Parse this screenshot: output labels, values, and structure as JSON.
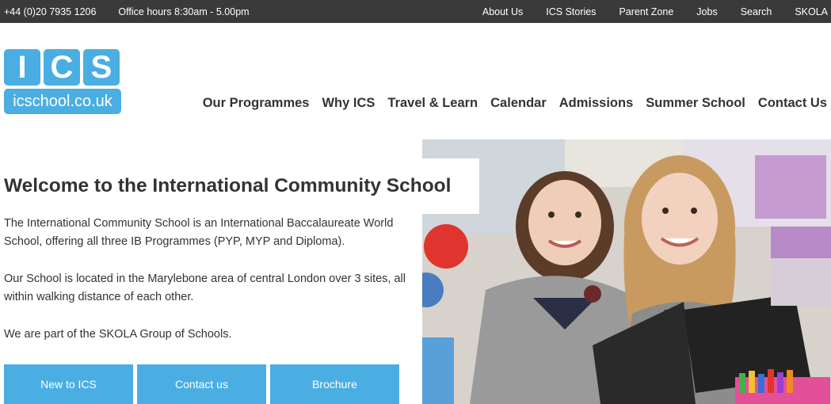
{
  "topbar": {
    "phone": "+44 (0)20 7935 1206",
    "hours": "Office hours 8:30am - 5.00pm",
    "links": [
      "About Us",
      "ICS Stories",
      "Parent Zone",
      "Jobs",
      "Search",
      "SKOLA"
    ]
  },
  "logo": {
    "letters": [
      "I",
      "C",
      "S"
    ],
    "domain": "icschool.co.uk"
  },
  "nav": {
    "items": [
      "Our Programmes",
      "Why ICS",
      "Travel & Learn",
      "Calendar",
      "Admissions",
      "Summer School",
      "Contact Us"
    ]
  },
  "main": {
    "headline": "Welcome to the International Community School",
    "paragraphs": [
      "The International Community School is an International Baccalaureate World School, offering all three IB Programmes (PYP, MYP and Diploma).",
      "Our School is located in the Marylebone area of central London over 3 sites, all within walking distance of each other.",
      "We are part of the SKOLA Group of Schools."
    ],
    "buttons": [
      "New to ICS",
      "Contact us",
      "Brochure"
    ]
  },
  "colors": {
    "brand_blue": "#4aaee3",
    "topbar_bg": "#3a3a3a"
  }
}
